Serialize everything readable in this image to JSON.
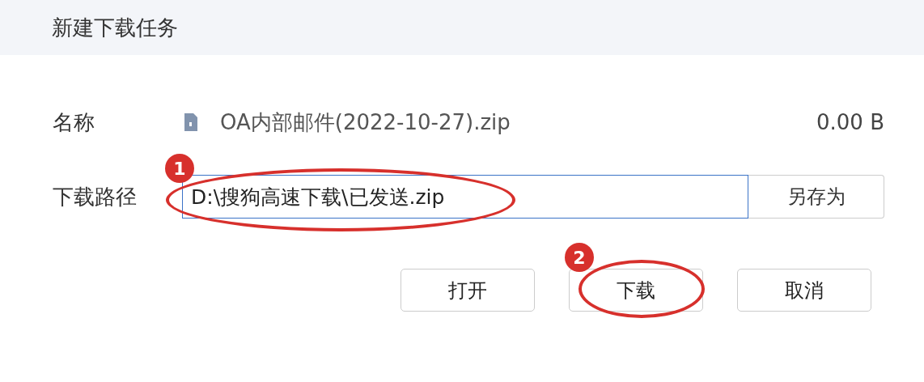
{
  "dialog": {
    "title": "新建下载任务"
  },
  "name_row": {
    "label": "名称",
    "filename": "OA内部邮件(2022-10-27).zip",
    "size": "0.00 B"
  },
  "path_row": {
    "label": "下载路径",
    "value": "D:\\搜狗高速下载\\已发送.zip",
    "button": "另存为"
  },
  "buttons": [
    {
      "label": "打开"
    },
    {
      "label": "下载"
    },
    {
      "label": "取消"
    }
  ],
  "annotations": [
    {
      "label": "1"
    },
    {
      "label": "2"
    }
  ]
}
